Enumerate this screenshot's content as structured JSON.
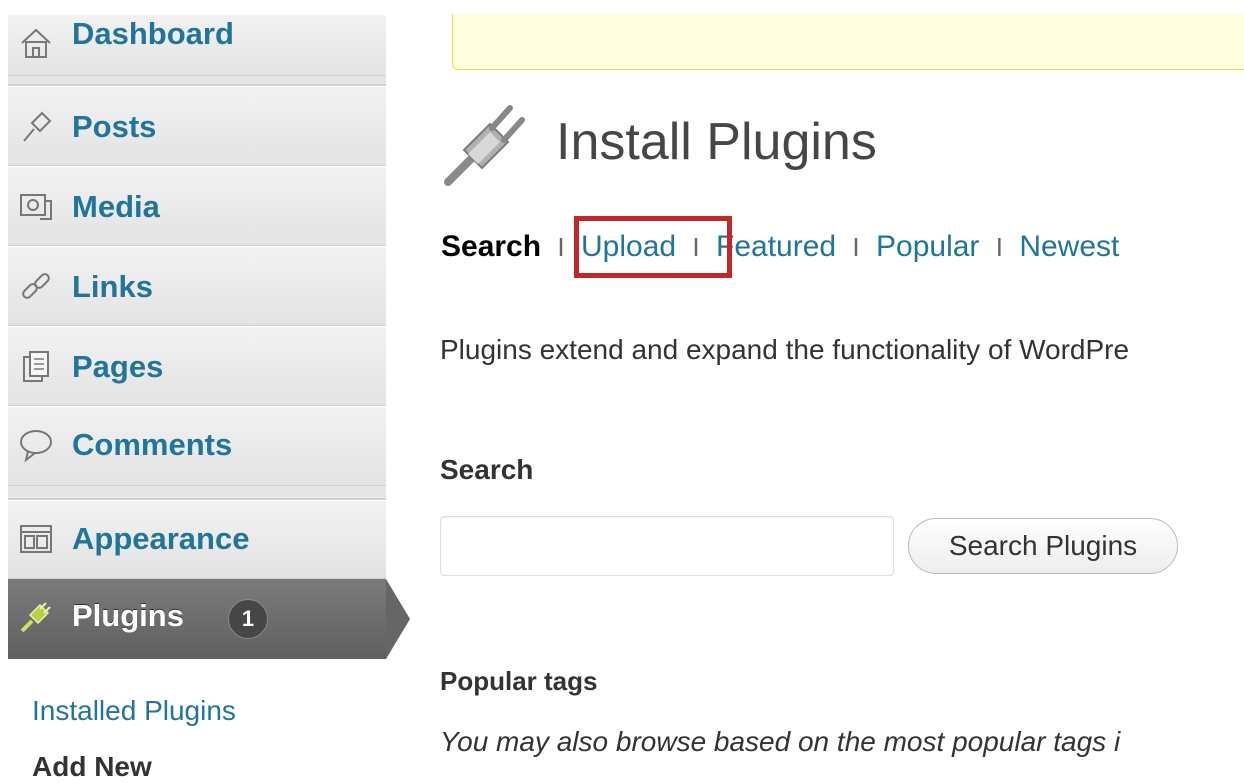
{
  "sidebar": {
    "items": [
      {
        "label": "Dashboard",
        "icon": "dashboard-icon"
      },
      {
        "label": "Posts",
        "icon": "posts-icon"
      },
      {
        "label": "Media",
        "icon": "media-icon"
      },
      {
        "label": "Links",
        "icon": "links-icon"
      },
      {
        "label": "Pages",
        "icon": "pages-icon"
      },
      {
        "label": "Comments",
        "icon": "comments-icon"
      },
      {
        "label": "Appearance",
        "icon": "appearance-icon"
      }
    ],
    "active": {
      "label": "Plugins",
      "badge": "1",
      "icon": "plugins-icon"
    },
    "submenu": [
      {
        "label": "Installed Plugins"
      },
      {
        "label": "Add New"
      }
    ]
  },
  "main": {
    "title": "Install Plugins",
    "tabs": {
      "current": "Search",
      "links": [
        "Upload",
        "Featured",
        "Popular",
        "Newest"
      ],
      "separator": "I"
    },
    "intro": "Plugins extend and expand the functionality of WordPre",
    "search": {
      "heading": "Search",
      "input_value": "",
      "button_label": "Search Plugins"
    },
    "popular_tags": {
      "heading": "Popular tags",
      "text": "You may also browse based on the most popular tags i"
    }
  },
  "colors": {
    "link": "#21759b",
    "highlight": "#c0282b",
    "notice_bg": "#ffffe0",
    "active_menu": "#666666"
  }
}
